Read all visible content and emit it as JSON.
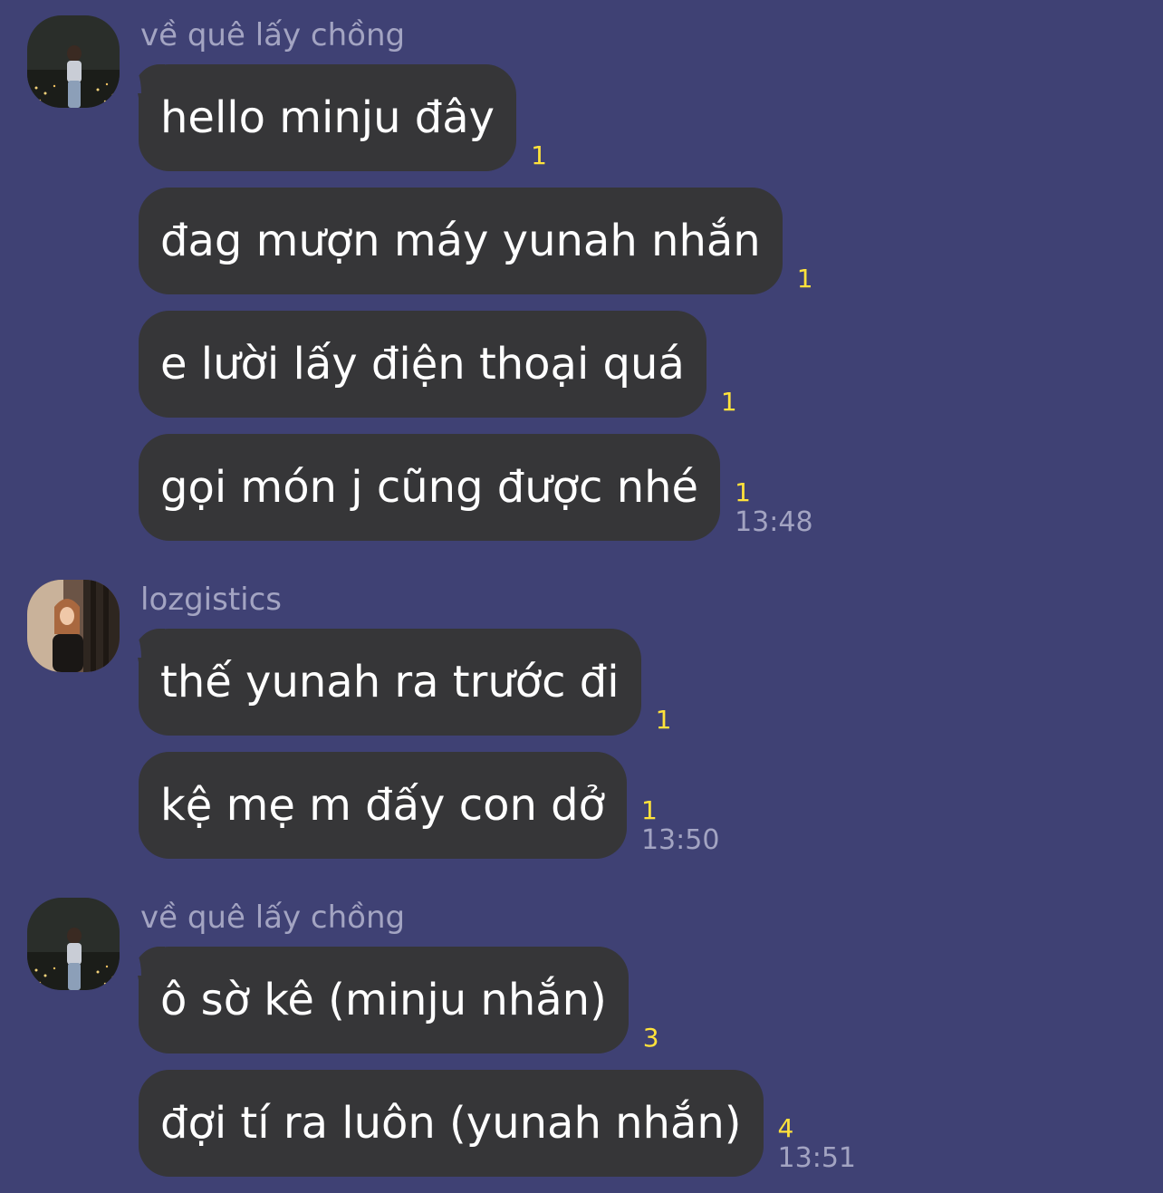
{
  "groups": [
    {
      "sender": "về quê lấy chồng",
      "avatar": "avatar-night-city",
      "messages": [
        {
          "text": "hello minju đây",
          "unread": "1"
        },
        {
          "text": "đag mượn máy yunah nhắn",
          "unread": "1"
        },
        {
          "text": "e lười lấy điện thoại quá",
          "unread": "1"
        },
        {
          "text": "gọi món j cũng được nhé",
          "unread": "1",
          "time": "13:48"
        }
      ]
    },
    {
      "sender": "lozgistics",
      "avatar": "avatar-girl-indoor",
      "messages": [
        {
          "text": "thế yunah ra trước đi",
          "unread": "1"
        },
        {
          "text": "kệ mẹ m đấy con dở",
          "unread": "1",
          "time": "13:50"
        }
      ]
    },
    {
      "sender": "về quê lấy chồng",
      "avatar": "avatar-night-city",
      "messages": [
        {
          "text": "ô sờ kê (minju nhắn)",
          "unread": "3"
        },
        {
          "text": "đợi tí ra luôn (yunah nhắn)",
          "unread": "4",
          "time": "13:51"
        }
      ]
    }
  ],
  "colors": {
    "background": "#3f4174",
    "bubble": "#363638",
    "unread": "#ffe23b",
    "meta_text": "#a3a4c2"
  }
}
